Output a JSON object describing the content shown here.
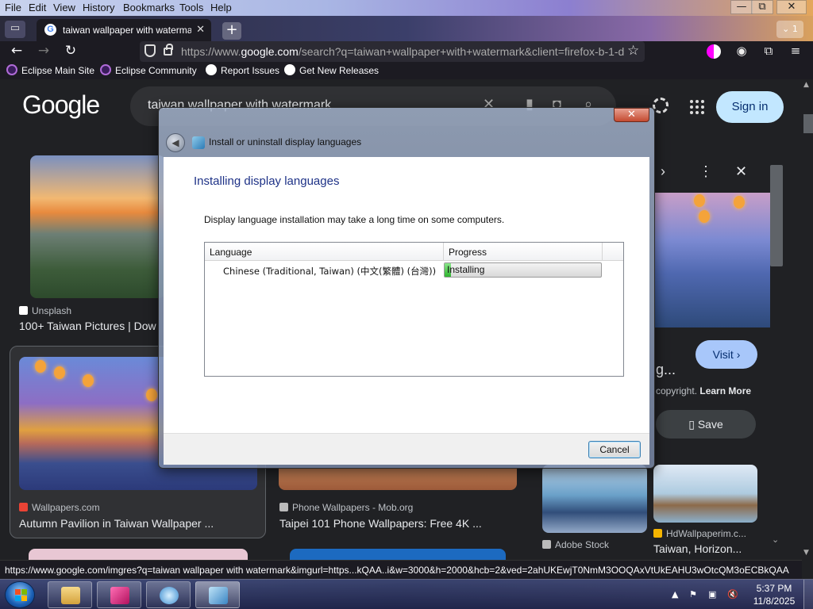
{
  "browser": {
    "menu": [
      "File",
      "Edit",
      "View",
      "History",
      "Bookmarks",
      "Tools",
      "Help"
    ],
    "window_controls": {
      "minimize": "—",
      "restore": "⧉",
      "close": "✕"
    },
    "tab": {
      "title": "taiwan wallpaper with watermark",
      "close": "✕"
    },
    "new_tab": "+",
    "tab_count": "⌄ 1",
    "url_prefix": "https://www.",
    "url_domain": "google.com",
    "url_rest": "/search?q=taiwan+wallpaper+with+watermark&client=firefox-b-1-d",
    "bookmarks": [
      "Eclipse Main Site",
      "Eclipse Community",
      "Report Issues",
      "Get New Releases"
    ],
    "status_url": "https://www.google.com/imgres?q=taiwan wallpaper with watermark&imgurl=https...kQAA..i&w=3000&h=2000&hcb=2&ved=2ahUKEwjT0NmM3OOQAxVtUkEAHU3wOtcQM3oECBkQAA"
  },
  "google": {
    "logo": "Google",
    "query": "taiwan wallpaper with watermark",
    "sign_in": "Sign in",
    "results": [
      {
        "source": "Unsplash",
        "title": "100+ Taiwan Pictures | Dow"
      },
      {
        "source": "Wallpapers.com",
        "title": "Autumn Pavilion in Taiwan Wallpaper ..."
      },
      {
        "source": "Phone Wallpapers - Mob.org",
        "title": "Taipei 101 Phone Wallpapers: Free 4K ..."
      },
      {
        "source": "Adobe Stock",
        "title": ""
      },
      {
        "source": "HdWallpaperim.c...",
        "title": "Taiwan, Horizon..."
      }
    ],
    "side_panel": {
      "visit": "Visit",
      "title_tail": "g...",
      "copyright": "copyright.",
      "learn_more": "Learn More",
      "save": "Save"
    }
  },
  "dialog": {
    "close": "✕",
    "window_title": "Install or uninstall display languages",
    "heading": "Installing display languages",
    "description": "Display language installation may take a long time on some computers.",
    "columns": [
      "Language",
      "Progress"
    ],
    "rows": [
      {
        "language": "Chinese (Traditional, Taiwan) (中文(繁體) (台灣))",
        "status": "Installing",
        "progress": 0.04
      }
    ],
    "cancel": "Cancel"
  },
  "taskbar": {
    "time": "5:37 PM",
    "date": "11/8/2025"
  },
  "colors": {
    "accent_blue": "#c2e7ff",
    "progress_green": "#2fb32f",
    "dialog_heading": "#1e3287"
  }
}
